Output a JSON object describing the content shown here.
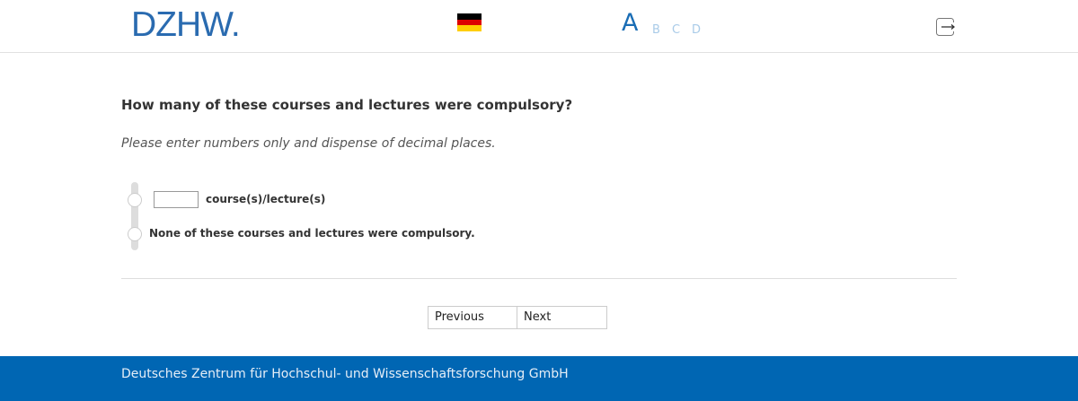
{
  "header": {
    "logo_text": "DZHW",
    "logo_dot": ".",
    "language_flag": {
      "icon": "german-flag-icon",
      "colors": [
        "#000000",
        "#dd0000",
        "#ffce00"
      ]
    },
    "versions": [
      "A",
      "B",
      "C",
      "D"
    ],
    "logout_icon": "logout-icon"
  },
  "question": {
    "title": "How many of these courses and lectures were compulsory?",
    "instruction": "Please enter numbers only and dispense of decimal places.",
    "options": [
      {
        "label": "course(s)/lecture(s)",
        "input_value": "",
        "selected": false
      },
      {
        "label": "None of these courses and lectures were compulsory.",
        "selected": false
      }
    ]
  },
  "navigation": {
    "previous_label": "Previous",
    "next_label": "Next"
  },
  "footer": {
    "text": "Deutsches Zentrum für Hochschul- und Wissenschaftsforschung GmbH"
  },
  "colors": {
    "brand_blue": "#0066b3",
    "logo_blue": "#2a6bb0",
    "inactive_version": "#a9cbe8"
  }
}
